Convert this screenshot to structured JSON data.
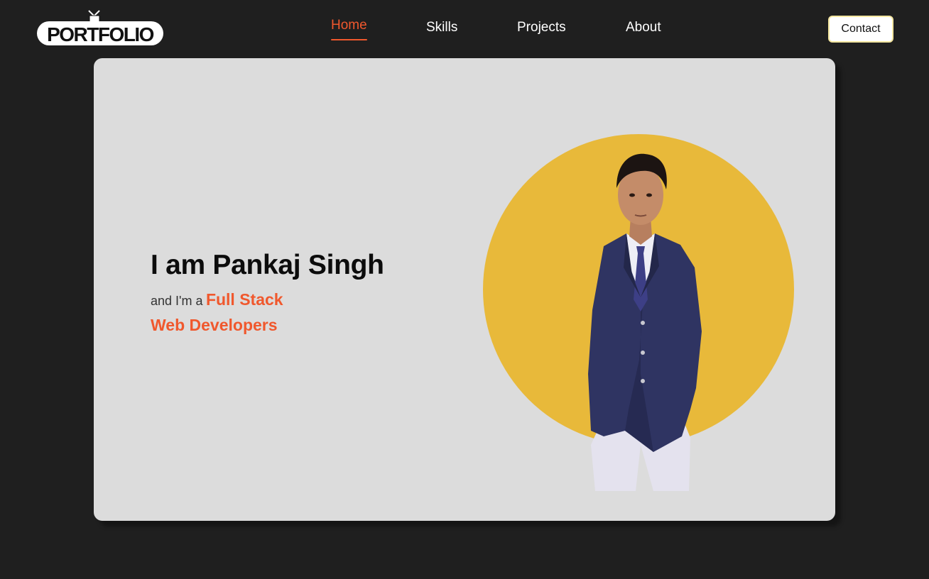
{
  "header": {
    "logo_text": "PORTFOLIO",
    "nav": [
      {
        "label": "Home",
        "active": true
      },
      {
        "label": "Skills",
        "active": false
      },
      {
        "label": "Projects",
        "active": false
      },
      {
        "label": "About",
        "active": false
      }
    ],
    "contact_label": "Contact"
  },
  "hero": {
    "title": "I am Pankaj Singh",
    "subtitle_prefix": "and I'm a",
    "role_line1": "Full Stack",
    "role_line2": "Web Developers"
  },
  "colors": {
    "background": "#1f1f1f",
    "card": "#dcdcdc",
    "accent": "#f0582d",
    "circle": "#e8b93a"
  }
}
